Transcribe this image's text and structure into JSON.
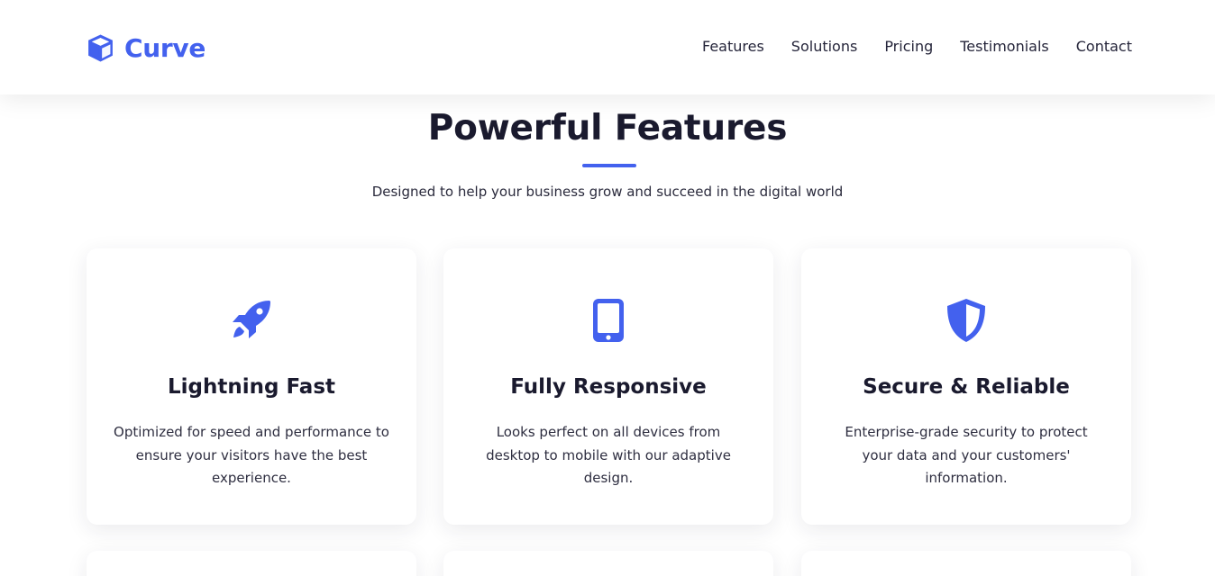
{
  "brand": {
    "name": "Curve",
    "icon": "cube-icon",
    "color": "#4361ee"
  },
  "nav": {
    "items": [
      {
        "label": "Features"
      },
      {
        "label": "Solutions"
      },
      {
        "label": "Pricing"
      },
      {
        "label": "Testimonials"
      },
      {
        "label": "Contact"
      }
    ]
  },
  "features_section": {
    "title": "Powerful Features",
    "subtitle": "Designed to help your business grow and succeed in the digital world",
    "cards": [
      {
        "icon": "rocket-icon",
        "title": "Lightning Fast",
        "text": "Optimized for speed and performance to ensure your visitors have the best experience."
      },
      {
        "icon": "mobile-icon",
        "title": "Fully Responsive",
        "text": "Looks perfect on all devices from desktop to mobile with our adaptive design."
      },
      {
        "icon": "shield-icon",
        "title": "Secure & Reliable",
        "text": "Enterprise-grade security to protect your data and your customers' information."
      }
    ]
  },
  "colors": {
    "accent": "#4361ee",
    "heading": "#1a1a2e",
    "body_text": "#2e2e40"
  }
}
